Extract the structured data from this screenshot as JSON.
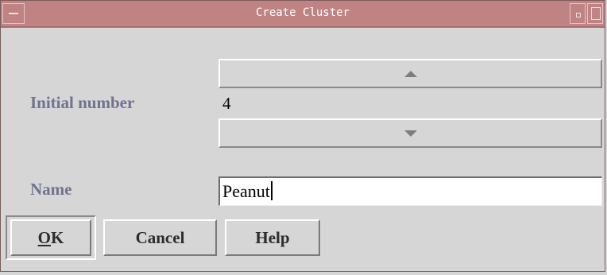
{
  "window": {
    "title": "Create Cluster"
  },
  "form": {
    "initial_number_label": "Initial number",
    "initial_number_value": "4",
    "name_label": "Name",
    "name_value": "Peanut"
  },
  "buttons": {
    "ok_mnemonic": "O",
    "ok_rest": "K",
    "cancel": "Cancel",
    "help": "Help"
  },
  "icons": {
    "window_menu": "window-menu-icon",
    "minimize": "minimize-icon",
    "maximize": "maximize-icon",
    "spin_up": "triangle-up-icon",
    "spin_down": "triangle-down-icon"
  },
  "colors": {
    "titlebar": "#c08383",
    "background": "#d6d6d6",
    "label_text": "#6f7390"
  }
}
